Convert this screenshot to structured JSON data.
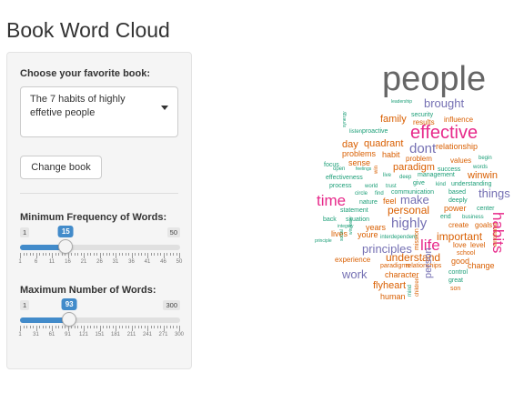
{
  "app": {
    "title": "Book Word Cloud"
  },
  "book_select": {
    "label": "Choose your favorite book:",
    "value": "The 7 habits of highly effetive people"
  },
  "change_button": {
    "label": "Change book"
  },
  "freq_slider": {
    "label": "Minimum Frequency of Words:",
    "min": 1,
    "max": 50,
    "value": 15,
    "min_label": "1",
    "max_label": "50",
    "value_label": "15",
    "tick_labels": [
      "1",
      "6",
      "11",
      "16",
      "21",
      "26",
      "31",
      "36",
      "41",
      "46",
      "50"
    ]
  },
  "words_slider": {
    "label": "Maximum Number of Words:",
    "min": 1,
    "max": 300,
    "value": 93,
    "min_label": "1",
    "max_label": "300",
    "value_label": "93",
    "tick_labels": [
      "1",
      "31",
      "61",
      "91",
      "121",
      "151",
      "181",
      "211",
      "241",
      "271",
      "300"
    ]
  },
  "colors": {
    "accent": "#428bca",
    "brown": "#d95f02",
    "teal": "#1b9e77",
    "purple": "#7570b3",
    "magenta": "#e7298a",
    "gray": "#666666"
  },
  "word_cloud": {
    "words": [
      {
        "text": "people",
        "color": "#666666",
        "size": 38
      },
      {
        "text": "leadership",
        "color": "#1b9e77",
        "size": 5
      },
      {
        "text": "brought",
        "color": "#7570b3",
        "size": 13
      },
      {
        "text": "family",
        "color": "#d95f02",
        "size": 11
      },
      {
        "text": "security",
        "color": "#1b9e77",
        "size": 7
      },
      {
        "text": "results",
        "color": "#d95f02",
        "size": 8
      },
      {
        "text": "influence",
        "color": "#d95f02",
        "size": 8
      },
      {
        "text": "listen",
        "color": "#1b9e77",
        "size": 6
      },
      {
        "text": "proactive",
        "color": "#1b9e77",
        "size": 7
      },
      {
        "text": "effective",
        "color": "#e7298a",
        "size": 20
      },
      {
        "text": "day",
        "color": "#d95f02",
        "size": 11
      },
      {
        "text": "quadrant",
        "color": "#d95f02",
        "size": 11
      },
      {
        "text": "dont",
        "color": "#7570b3",
        "size": 15
      },
      {
        "text": "relationship",
        "color": "#d95f02",
        "size": 9
      },
      {
        "text": "problems",
        "color": "#d95f02",
        "size": 9
      },
      {
        "text": "habit",
        "color": "#d95f02",
        "size": 9
      },
      {
        "text": "problem",
        "color": "#d95f02",
        "size": 8
      },
      {
        "text": "focus",
        "color": "#1b9e77",
        "size": 7
      },
      {
        "text": "sense",
        "color": "#d95f02",
        "size": 9
      },
      {
        "text": "values",
        "color": "#d95f02",
        "size": 8
      },
      {
        "text": "begin",
        "color": "#1b9e77",
        "size": 6
      },
      {
        "text": "open",
        "color": "#1b9e77",
        "size": 6
      },
      {
        "text": "feelings",
        "color": "#1b9e77",
        "size": 5
      },
      {
        "text": "paradigm",
        "color": "#d95f02",
        "size": 11
      },
      {
        "text": "success",
        "color": "#1b9e77",
        "size": 7
      },
      {
        "text": "words",
        "color": "#1b9e77",
        "size": 6
      },
      {
        "text": "effectiveness",
        "color": "#1b9e77",
        "size": 7
      },
      {
        "text": "live",
        "color": "#1b9e77",
        "size": 6
      },
      {
        "text": "deep",
        "color": "#1b9e77",
        "size": 6
      },
      {
        "text": "management",
        "color": "#1b9e77",
        "size": 7
      },
      {
        "text": "winwin",
        "color": "#d95f02",
        "size": 11
      },
      {
        "text": "process",
        "color": "#1b9e77",
        "size": 7
      },
      {
        "text": "world",
        "color": "#1b9e77",
        "size": 6
      },
      {
        "text": "trust",
        "color": "#1b9e77",
        "size": 6
      },
      {
        "text": "give",
        "color": "#1b9e77",
        "size": 7
      },
      {
        "text": "kind",
        "color": "#1b9e77",
        "size": 6
      },
      {
        "text": "understanding",
        "color": "#1b9e77",
        "size": 7
      },
      {
        "text": "circle",
        "color": "#1b9e77",
        "size": 6
      },
      {
        "text": "find",
        "color": "#1b9e77",
        "size": 6
      },
      {
        "text": "communication",
        "color": "#1b9e77",
        "size": 7
      },
      {
        "text": "based",
        "color": "#1b9e77",
        "size": 7
      },
      {
        "text": "things",
        "color": "#7570b3",
        "size": 13
      },
      {
        "text": "time",
        "color": "#e7298a",
        "size": 17
      },
      {
        "text": "nature",
        "color": "#1b9e77",
        "size": 7
      },
      {
        "text": "feel",
        "color": "#d95f02",
        "size": 9
      },
      {
        "text": "make",
        "color": "#7570b3",
        "size": 13
      },
      {
        "text": "deeply",
        "color": "#1b9e77",
        "size": 7
      },
      {
        "text": "statement",
        "color": "#1b9e77",
        "size": 7
      },
      {
        "text": "personal",
        "color": "#d95f02",
        "size": 12
      },
      {
        "text": "power",
        "color": "#d95f02",
        "size": 9
      },
      {
        "text": "center",
        "color": "#1b9e77",
        "size": 7
      },
      {
        "text": "back",
        "color": "#1b9e77",
        "size": 7
      },
      {
        "text": "situation",
        "color": "#1b9e77",
        "size": 7
      },
      {
        "text": "end",
        "color": "#1b9e77",
        "size": 7
      },
      {
        "text": "business",
        "color": "#1b9e77",
        "size": 6
      },
      {
        "text": "integrity",
        "color": "#1b9e77",
        "size": 5
      },
      {
        "text": "years",
        "color": "#d95f02",
        "size": 9
      },
      {
        "text": "highly",
        "color": "#7570b3",
        "size": 15
      },
      {
        "text": "create",
        "color": "#d95f02",
        "size": 8
      },
      {
        "text": "goals",
        "color": "#d95f02",
        "size": 8
      },
      {
        "text": "lives",
        "color": "#d95f02",
        "size": 9
      },
      {
        "text": "youre",
        "color": "#d95f02",
        "size": 9
      },
      {
        "text": "interdependent",
        "color": "#1b9e77",
        "size": 6
      },
      {
        "text": "important",
        "color": "#d95f02",
        "size": 12
      },
      {
        "text": "habits",
        "color": "#e7298a",
        "size": 17
      },
      {
        "text": "principle",
        "color": "#1b9e77",
        "size": 5
      },
      {
        "text": "principles",
        "color": "#7570b3",
        "size": 13
      },
      {
        "text": "life",
        "color": "#e7298a",
        "size": 17
      },
      {
        "text": "love",
        "color": "#d95f02",
        "size": 8
      },
      {
        "text": "level",
        "color": "#d95f02",
        "size": 8
      },
      {
        "text": "school",
        "color": "#d95f02",
        "size": 7
      },
      {
        "text": "experience",
        "color": "#d95f02",
        "size": 8
      },
      {
        "text": "understand",
        "color": "#d95f02",
        "size": 12
      },
      {
        "text": "good",
        "color": "#d95f02",
        "size": 9
      },
      {
        "text": "change",
        "color": "#d95f02",
        "size": 9
      },
      {
        "text": "paradigms",
        "color": "#d95f02",
        "size": 7
      },
      {
        "text": "relationships",
        "color": "#d95f02",
        "size": 7
      },
      {
        "text": "work",
        "color": "#7570b3",
        "size": 13
      },
      {
        "text": "character",
        "color": "#d95f02",
        "size": 9
      },
      {
        "text": "control",
        "color": "#1b9e77",
        "size": 7
      },
      {
        "text": "great",
        "color": "#1b9e77",
        "size": 7
      },
      {
        "text": "flyheart",
        "color": "#d95f02",
        "size": 11
      },
      {
        "text": "son",
        "color": "#d95f02",
        "size": 7
      },
      {
        "text": "human",
        "color": "#d95f02",
        "size": 9
      },
      {
        "text": "person",
        "color": "#7570b3",
        "size": 11
      },
      {
        "text": "mission",
        "color": "#d95f02",
        "size": 7
      },
      {
        "text": "synergy",
        "color": "#1b9e77",
        "size": 5
      },
      {
        "text": "social",
        "color": "#1b9e77",
        "size": 5
      },
      {
        "text": "emotional",
        "color": "#d95f02",
        "size": 6
      },
      {
        "text": "mind",
        "color": "#1b9e77",
        "size": 6
      },
      {
        "text": "children",
        "color": "#d95f02",
        "size": 6
      },
      {
        "text": "win",
        "color": "#d95f02",
        "size": 6
      },
      {
        "text": "win/lose",
        "color": "#1b9e77",
        "size": 5
      }
    ]
  }
}
